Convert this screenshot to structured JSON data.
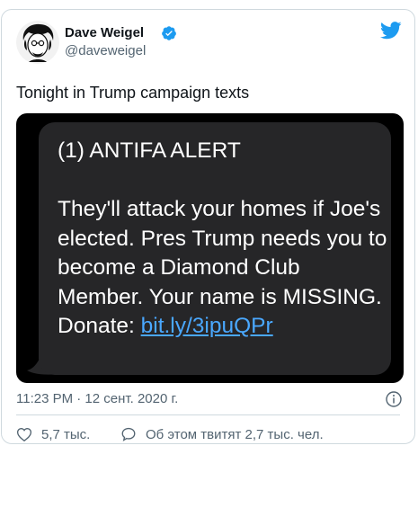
{
  "tweet": {
    "author_name": "Dave Weigel",
    "handle": "@daveweigel",
    "text": "Tonight in Trump campaign texts",
    "timestamp": "11:23 PM · 12 сент. 2020 г.",
    "likes": "5,7 тыс.",
    "retweet_text": "Об этом твитят 2,7 тыс. чел."
  },
  "sms": {
    "heading": "(1) ANTIFA ALERT",
    "body": "They'll attack your homes if Joe's elected. Pres Trump needs you to become a Diamond Club Member. Your name is MISSING. Donate: ",
    "link": "bit.ly/3ipuQPr"
  },
  "icons": {
    "verified": "verified-badge-icon",
    "twitter": "twitter-bird-icon",
    "info": "info-icon",
    "like": "heart-icon",
    "reply": "speech-bubble-icon"
  },
  "colors": {
    "verified_blue": "#1d9bf0",
    "sms_bubble": "#262628",
    "sms_link": "#4aa8ff",
    "muted_text": "#536471"
  }
}
